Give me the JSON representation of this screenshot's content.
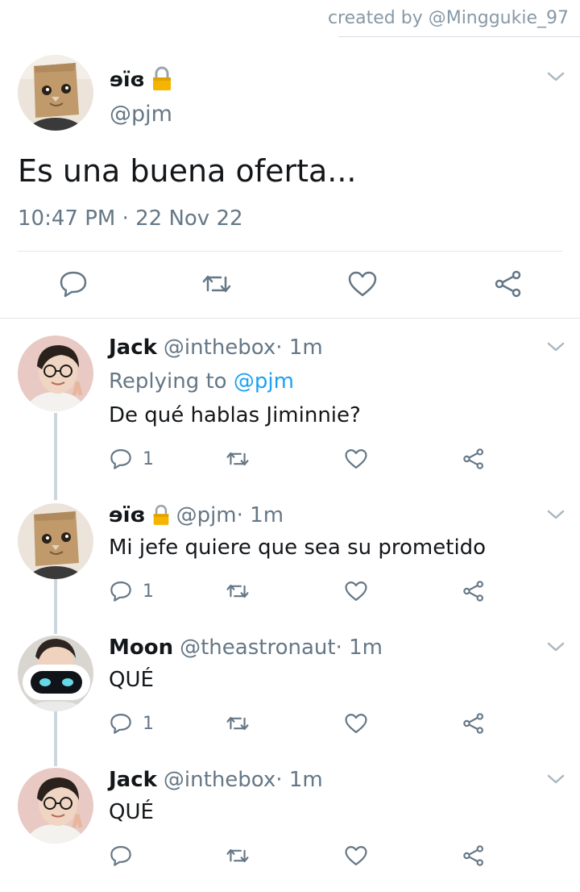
{
  "credit": "created by @Minggukie_97",
  "main_tweet": {
    "name": "ɘïɞ",
    "lock_icon": "lock-icon",
    "handle": "@pjm",
    "text": "Es una buena oferta...",
    "timestamp": "10:47 PM · 22 Nov 22"
  },
  "replies": [
    {
      "name": "Jack",
      "handle": "@inthebox",
      "time": " · 1m",
      "replying_prefix": "Replying to ",
      "replying_mention": "@pjm",
      "text": "De qué hablas Jiminnie?",
      "reply_count": "1"
    },
    {
      "name": "ɘïɞ",
      "handle": "@pjm",
      "time": " · 1m",
      "text": "Mi jefe quiere que sea su prometido",
      "reply_count": "1"
    },
    {
      "name": "Moon",
      "handle": "@theastronaut",
      "time": " · 1m",
      "text": "QUÉ",
      "reply_count": "1"
    },
    {
      "name": "Jack",
      "handle": "@inthebox",
      "time": " · 1m",
      "text": "QUÉ",
      "reply_count": ""
    }
  ],
  "colors": {
    "text": "#14171a",
    "secondary": "#657786",
    "link": "#1da1f2",
    "thread_line": "#ccd6dd",
    "lock": "#f4b400"
  }
}
